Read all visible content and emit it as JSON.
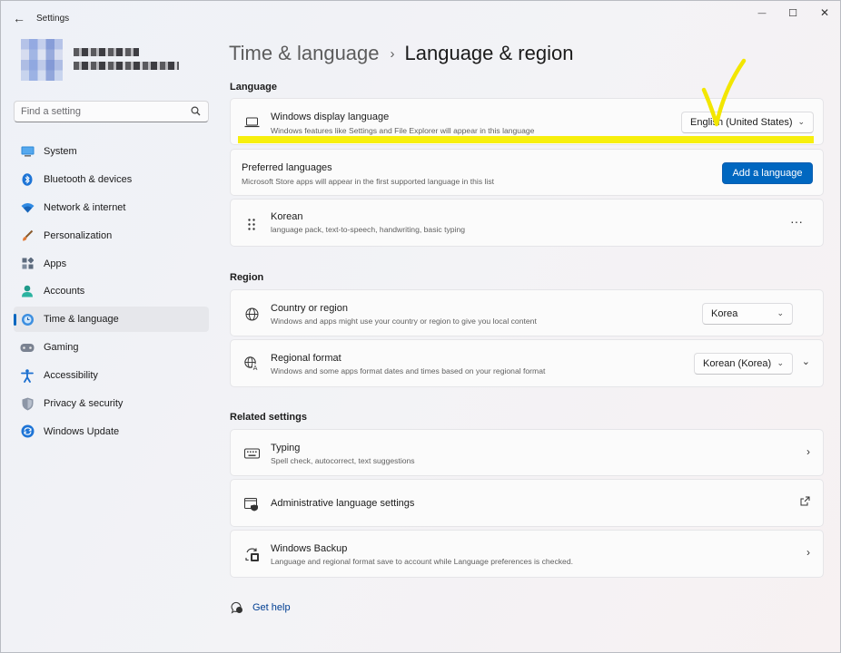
{
  "window": {
    "title": "Settings",
    "back_icon": "back-arrow-icon",
    "controls": {
      "minimize": "—",
      "maximize": "☐",
      "close": "✕"
    }
  },
  "search": {
    "placeholder": "Find a setting",
    "icon": "search-icon"
  },
  "nav": {
    "items": [
      {
        "label": "System",
        "icon": "monitor-icon"
      },
      {
        "label": "Bluetooth & devices",
        "icon": "bluetooth-icon"
      },
      {
        "label": "Network & internet",
        "icon": "wifi-icon"
      },
      {
        "label": "Personalization",
        "icon": "brush-icon"
      },
      {
        "label": "Apps",
        "icon": "apps-icon"
      },
      {
        "label": "Accounts",
        "icon": "person-icon"
      },
      {
        "label": "Time & language",
        "icon": "globe-clock-icon",
        "active": true
      },
      {
        "label": "Gaming",
        "icon": "gamepad-icon"
      },
      {
        "label": "Accessibility",
        "icon": "accessibility-icon"
      },
      {
        "label": "Privacy & security",
        "icon": "shield-icon"
      },
      {
        "label": "Windows Update",
        "icon": "update-icon"
      }
    ]
  },
  "breadcrumb": {
    "parent": "Time & language",
    "separator": "›",
    "current": "Language & region"
  },
  "language_section": {
    "title": "Language",
    "display_language": {
      "title": "Windows display language",
      "subtitle": "Windows features like Settings and File Explorer will appear in this language",
      "value": "English (United States)"
    },
    "preferred": {
      "title": "Preferred languages",
      "subtitle": "Microsoft Store apps will appear in the first supported language in this list",
      "button": "Add a language"
    },
    "korean": {
      "title": "Korean",
      "subtitle": "language pack, text-to-speech, handwriting, basic typing",
      "more": "···"
    }
  },
  "region_section": {
    "title": "Region",
    "country": {
      "title": "Country or region",
      "subtitle": "Windows and apps might use your country or region to give you local content",
      "value": "Korea"
    },
    "format": {
      "title": "Regional format",
      "subtitle": "Windows and some apps format dates and times based on your regional format",
      "value": "Korean (Korea)"
    }
  },
  "related_section": {
    "title": "Related settings",
    "typing": {
      "title": "Typing",
      "subtitle": "Spell check, autocorrect, text suggestions"
    },
    "admin": {
      "title": "Administrative language settings"
    },
    "backup": {
      "title": "Windows Backup",
      "subtitle": "Language and regional format save to account while Language preferences is checked."
    }
  },
  "help": {
    "label": "Get help"
  },
  "colors": {
    "accent": "#0067c0",
    "annotation": "#f7ee00"
  }
}
